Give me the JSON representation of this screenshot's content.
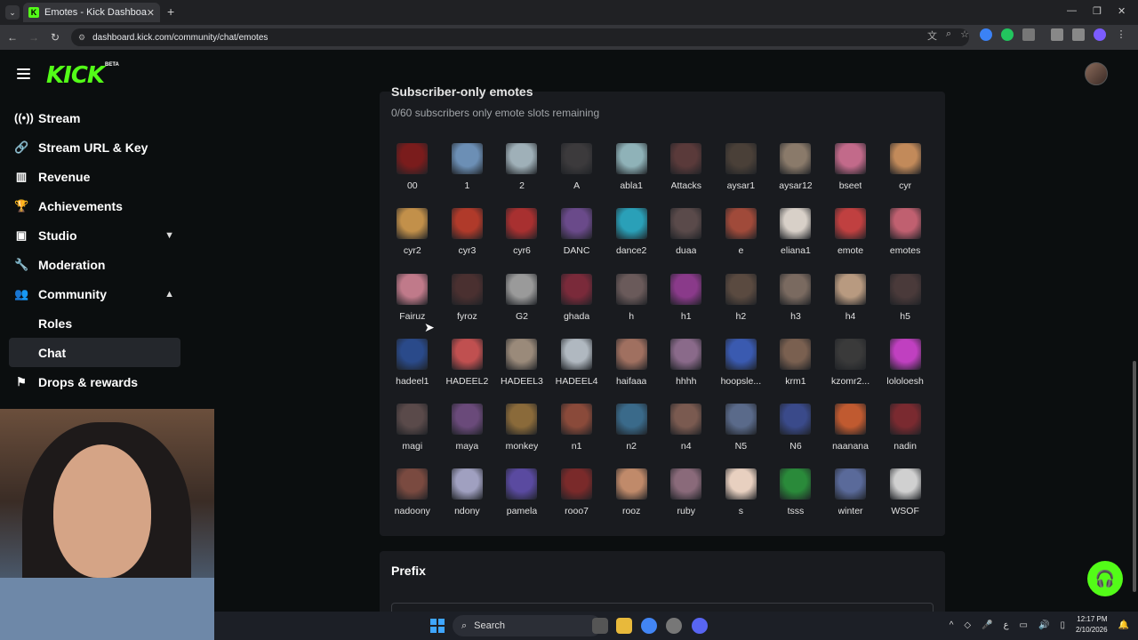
{
  "browser": {
    "tab_title": "Emotes - Kick Dashboard",
    "url": "dashboard.kick.com/community/chat/emotes"
  },
  "app": {
    "logo": "KICK",
    "badge": "BETA"
  },
  "sidebar": {
    "items": [
      {
        "label": "Stream",
        "icon": "broadcast-icon"
      },
      {
        "label": "Stream URL & Key",
        "icon": "link-icon"
      },
      {
        "label": "Revenue",
        "icon": "revenue-icon"
      },
      {
        "label": "Achievements",
        "icon": "trophy-icon"
      },
      {
        "label": "Studio",
        "icon": "studio-icon"
      },
      {
        "label": "Moderation",
        "icon": "wrench-icon"
      },
      {
        "label": "Community",
        "icon": "community-icon"
      },
      {
        "label": "Drops & rewards",
        "icon": "rewards-icon"
      }
    ],
    "community_sub": [
      {
        "label": "Roles"
      },
      {
        "label": "Chat"
      }
    ]
  },
  "emotes_section": {
    "title": "Subscriber-only emotes",
    "subtitle": "0/60 subscribers only emote slots remaining",
    "emotes": [
      "00",
      "1",
      "2",
      "A",
      "abla1",
      "Attacks",
      "aysar1",
      "aysar12",
      "bseet",
      "cyr",
      "cyr2",
      "cyr3",
      "cyr6",
      "DANC",
      "dance2",
      "duaa",
      "e",
      "eliana1",
      "emote",
      "emotes",
      "Fairuz",
      "fyroz",
      "G2",
      "ghada",
      "h",
      "h1",
      "h2",
      "h3",
      "h4",
      "h5",
      "hadeel1",
      "HADEEL2",
      "HADEEL3",
      "HADEEL4",
      "haifaaa",
      "hhhh",
      "hoopsle...",
      "krm1",
      "kzomr2...",
      "lololoesh",
      "magi",
      "maya",
      "monkey",
      "n1",
      "n2",
      "n4",
      "N5",
      "N6",
      "naanana",
      "nadin",
      "nadoony",
      "ndony",
      "pamela",
      "rooo7",
      "rooz",
      "ruby",
      "s",
      "tsss",
      "winter",
      "WSOF"
    ],
    "colors": [
      "#7a1c1c",
      "#6c8fb5",
      "#9fb0b8",
      "#3c3a3c",
      "#8fb2b8",
      "#5a3a3a",
      "#4a4038",
      "#8a7a6a",
      "#c26a8a",
      "#c28a5a",
      "#c2904a",
      "#b03a2a",
      "#a83030",
      "#6a4a8a",
      "#2aa0b8",
      "#5a4a4a",
      "#a04a3a",
      "#d8d0c8",
      "#c04040",
      "#c06070",
      "#c07a8a",
      "#4a3030",
      "#9a9a9a",
      "#7a2a3a",
      "#6a5a5a",
      "#8a3a8a",
      "#5a4a40",
      "#7a6a60",
      "#b89a80",
      "#4a3a3a",
      "#2a4a8a",
      "#c05050",
      "#9a8a7a",
      "#b0b8c0",
      "#a07060",
      "#8a6a8a",
      "#3a5ab0",
      "#7a6050",
      "#3a3a3a",
      "#c040c0",
      "#5a4a4a",
      "#6a4a7a",
      "#8a6a3a",
      "#8a4a3a",
      "#3a6a8a",
      "#7a5a50",
      "#5a6a8a",
      "#3a4a8a",
      "#c05a30",
      "#7a2a30",
      "#7a4a40",
      "#a0a0c0",
      "#5a4aa0",
      "#7a2a2a",
      "#c08a6a",
      "#8a6a7a",
      "#e8d0c0",
      "#2a8a3a",
      "#5a6a9a",
      "#d0d0d0"
    ]
  },
  "prefix_section": {
    "title": "Prefix"
  },
  "taskbar": {
    "search_label": "Search",
    "time": "12:17 PM",
    "date": "2/10/2026",
    "lang": "ع"
  },
  "accent": "#53fc18"
}
